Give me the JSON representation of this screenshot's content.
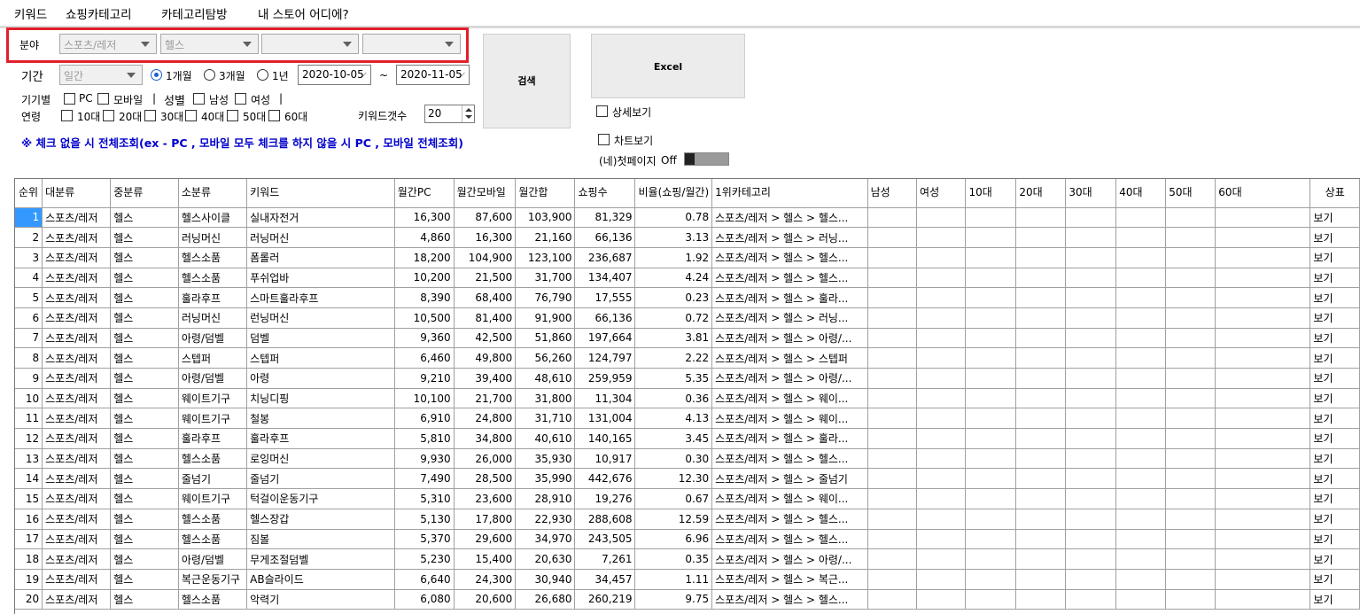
{
  "menu": [
    "키워드",
    "쇼핑카테고리",
    "카테고리탐방",
    "내 스토어 어디에?"
  ],
  "filters": {
    "field_label": "분야",
    "field_selects": [
      "스포츠/레저",
      "헬스",
      "",
      ""
    ],
    "period_label": "기간",
    "period_select": "일간",
    "period_options": [
      "1개월",
      "3개월",
      "1년"
    ],
    "date_from": "2020-10-05",
    "tilde": "~",
    "date_to": "2020-11-05",
    "device_label": "기기별",
    "device_pc": "PC",
    "device_mobile": "모바일",
    "sep": "|",
    "gender_label": "성별",
    "gender_male": "남성",
    "gender_female": "여성",
    "age_label": "연령",
    "ages": [
      "10대",
      "20대",
      "30대",
      "40대",
      "50대",
      "60대"
    ],
    "keyword_count_label": "키워드갯수",
    "keyword_count": "20",
    "notice": "※ 체크 없을 시 전체조회(ex -  PC , 모바일 모두 체크를 하지 않을 시 PC , 모바일 전체조회)"
  },
  "buttons": {
    "search": "검색",
    "excel": "Excel"
  },
  "options": {
    "detail_view": "상세보기",
    "chart_view": "차트보기",
    "naver_first_page": "(네)첫페이지",
    "toggle_state": "Off"
  },
  "table": {
    "headers": [
      "순위",
      "대분류",
      "중분류",
      "소분류",
      "키워드",
      "월간PC",
      "월간모바일",
      "월간합",
      "쇼핑수",
      "비율(쇼핑/월간)",
      "1위카테고리",
      "남성",
      "여성",
      "10대",
      "20대",
      "30대",
      "40대",
      "50대",
      "60대",
      "상표"
    ],
    "rows": [
      [
        "1",
        "스포츠/레저",
        "헬스",
        "헬스사이클",
        "실내자전거",
        "16,300",
        "87,600",
        "103,900",
        "81,329",
        "0.78",
        "스포츠/레저 > 헬스 > 헬스...",
        "보기"
      ],
      [
        "2",
        "스포츠/레저",
        "헬스",
        "러닝머신",
        "러닝머신",
        "4,860",
        "16,300",
        "21,160",
        "66,136",
        "3.13",
        "스포츠/레저 > 헬스 > 러닝...",
        "보기"
      ],
      [
        "3",
        "스포츠/레저",
        "헬스",
        "헬스소품",
        "폼롤러",
        "18,200",
        "104,900",
        "123,100",
        "236,687",
        "1.92",
        "스포츠/레저 > 헬스 > 헬스...",
        "보기"
      ],
      [
        "4",
        "스포츠/레저",
        "헬스",
        "헬스소품",
        "푸쉬업바",
        "10,200",
        "21,500",
        "31,700",
        "134,407",
        "4.24",
        "스포츠/레저 > 헬스 > 헬스...",
        "보기"
      ],
      [
        "5",
        "스포츠/레저",
        "헬스",
        "훌라후프",
        "스마트훌라후프",
        "8,390",
        "68,400",
        "76,790",
        "17,555",
        "0.23",
        "스포츠/레저 > 헬스 > 훌라...",
        "보기"
      ],
      [
        "6",
        "스포츠/레저",
        "헬스",
        "러닝머신",
        "런닝머신",
        "10,500",
        "81,400",
        "91,900",
        "66,136",
        "0.72",
        "스포츠/레저 > 헬스 > 러닝...",
        "보기"
      ],
      [
        "7",
        "스포츠/레저",
        "헬스",
        "아령/덤벨",
        "덤벨",
        "9,360",
        "42,500",
        "51,860",
        "197,664",
        "3.81",
        "스포츠/레저 > 헬스 > 아령/...",
        "보기"
      ],
      [
        "8",
        "스포츠/레저",
        "헬스",
        "스텝퍼",
        "스텝퍼",
        "6,460",
        "49,800",
        "56,260",
        "124,797",
        "2.22",
        "스포츠/레저 > 헬스 > 스텝퍼",
        "보기"
      ],
      [
        "9",
        "스포츠/레저",
        "헬스",
        "아령/덤벨",
        "아령",
        "9,210",
        "39,400",
        "48,610",
        "259,959",
        "5.35",
        "스포츠/레저 > 헬스 > 아령/...",
        "보기"
      ],
      [
        "10",
        "스포츠/레저",
        "헬스",
        "웨이트기구",
        "치닝디핑",
        "10,100",
        "21,700",
        "31,800",
        "11,304",
        "0.36",
        "스포츠/레저 > 헬스 > 웨이...",
        "보기"
      ],
      [
        "11",
        "스포츠/레저",
        "헬스",
        "웨이트기구",
        "철봉",
        "6,910",
        "24,800",
        "31,710",
        "131,004",
        "4.13",
        "스포츠/레저 > 헬스 > 웨이...",
        "보기"
      ],
      [
        "12",
        "스포츠/레저",
        "헬스",
        "훌라후프",
        "훌라후프",
        "5,810",
        "34,800",
        "40,610",
        "140,165",
        "3.45",
        "스포츠/레저 > 헬스 > 훌라...",
        "보기"
      ],
      [
        "13",
        "스포츠/레저",
        "헬스",
        "헬스소품",
        "로잉머신",
        "9,930",
        "26,000",
        "35,930",
        "10,917",
        "0.30",
        "스포츠/레저 > 헬스 > 헬스...",
        "보기"
      ],
      [
        "14",
        "스포츠/레저",
        "헬스",
        "줄넘기",
        "줄넘기",
        "7,490",
        "28,500",
        "35,990",
        "442,676",
        "12.30",
        "스포츠/레저 > 헬스 > 줄넘기",
        "보기"
      ],
      [
        "15",
        "스포츠/레저",
        "헬스",
        "웨이트기구",
        "턱걸이운동기구",
        "5,310",
        "23,600",
        "28,910",
        "19,276",
        "0.67",
        "스포츠/레저 > 헬스 > 웨이...",
        "보기"
      ],
      [
        "16",
        "스포츠/레저",
        "헬스",
        "헬스소품",
        "헬스장갑",
        "5,130",
        "17,800",
        "22,930",
        "288,608",
        "12.59",
        "스포츠/레저 > 헬스 > 헬스...",
        "보기"
      ],
      [
        "17",
        "스포츠/레저",
        "헬스",
        "헬스소품",
        "짐볼",
        "5,370",
        "29,600",
        "34,970",
        "243,505",
        "6.96",
        "스포츠/레저 > 헬스 > 헬스...",
        "보기"
      ],
      [
        "18",
        "스포츠/레저",
        "헬스",
        "아령/덤벨",
        "무게조절덤벨",
        "5,230",
        "15,400",
        "20,630",
        "7,261",
        "0.35",
        "스포츠/레저 > 헬스 > 아령/...",
        "보기"
      ],
      [
        "19",
        "스포츠/레저",
        "헬스",
        "복근운동기구",
        "AB슬라이드",
        "6,640",
        "24,300",
        "30,940",
        "34,457",
        "1.11",
        "스포츠/레저 > 헬스 > 복근...",
        "보기"
      ],
      [
        "20",
        "스포츠/레저",
        "헬스",
        "헬스소품",
        "악력기",
        "6,080",
        "20,600",
        "26,680",
        "260,219",
        "9.75",
        "스포츠/레저 > 헬스 > 헬스...",
        "보기"
      ]
    ]
  }
}
